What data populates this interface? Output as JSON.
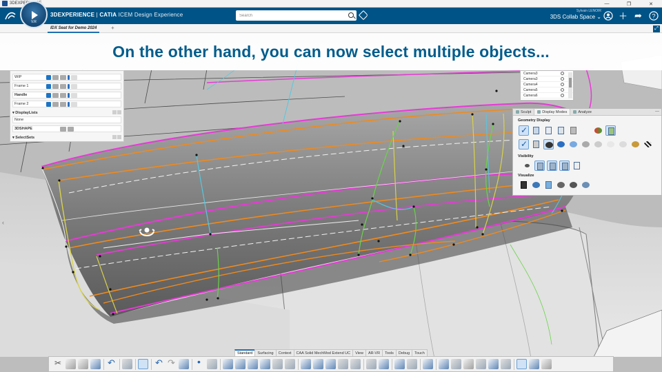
{
  "os": {
    "title": "3DEXPERIENCE",
    "controls": [
      "—",
      "❐",
      "✕"
    ]
  },
  "header": {
    "compass_version": "V.R",
    "brand_prefix": "3DEXPERIENCE",
    "brand_app": "CATIA",
    "brand_suffix": "ICEM Design Experience",
    "search_placeholder": "Search",
    "user_name": "Sylvain LENOIR",
    "collab_space": "3DS Collab Space",
    "icons": [
      "user-icon",
      "add-icon",
      "share-icon",
      "help-icon"
    ]
  },
  "tabs": {
    "active_label": "IDX Seat for Demo 2024",
    "add_label": "+"
  },
  "caption": {
    "text": "On the other hand, you can now select multiple objects..."
  },
  "tree_panel": {
    "rows": [
      {
        "label": "WIP",
        "bold": false
      },
      {
        "label": "Frame 1",
        "bold": false
      },
      {
        "label": "Handle",
        "bold": true
      },
      {
        "label": "Frame 2",
        "bold": false
      }
    ],
    "display_lists_title": "DisplayLists",
    "display_list_none": "None",
    "display_list_item": "3DSHAPE",
    "select_sets_title": "SelectSets"
  },
  "camera_list": {
    "items": [
      "Camera3",
      "Camera3",
      "Camera4",
      "Camera5",
      "Camera6"
    ]
  },
  "modes_panel": {
    "tabs": [
      "Sculpt",
      "Display Modes",
      "Analyze"
    ],
    "active_tab": "Display Modes",
    "geometry_title": "Geometry Display",
    "visibility_title": "Visibility",
    "visualize_title": "Visualize"
  },
  "context_tabs": [
    "Standard",
    "Surfacing",
    "Context",
    "CAA Solid MechMod Extend UC",
    "View",
    "AR-VR",
    "Tools",
    "Debug",
    "Touch"
  ],
  "context_active": "Standard",
  "colors": {
    "header": "#005386",
    "caption_text": "#005c8c",
    "curve_magenta": "#e63ad6",
    "curve_orange": "#f08a1c",
    "curve_yellow": "#d9d24a",
    "curve_green": "#6ad44a",
    "curve_cyan": "#55c8e0"
  }
}
